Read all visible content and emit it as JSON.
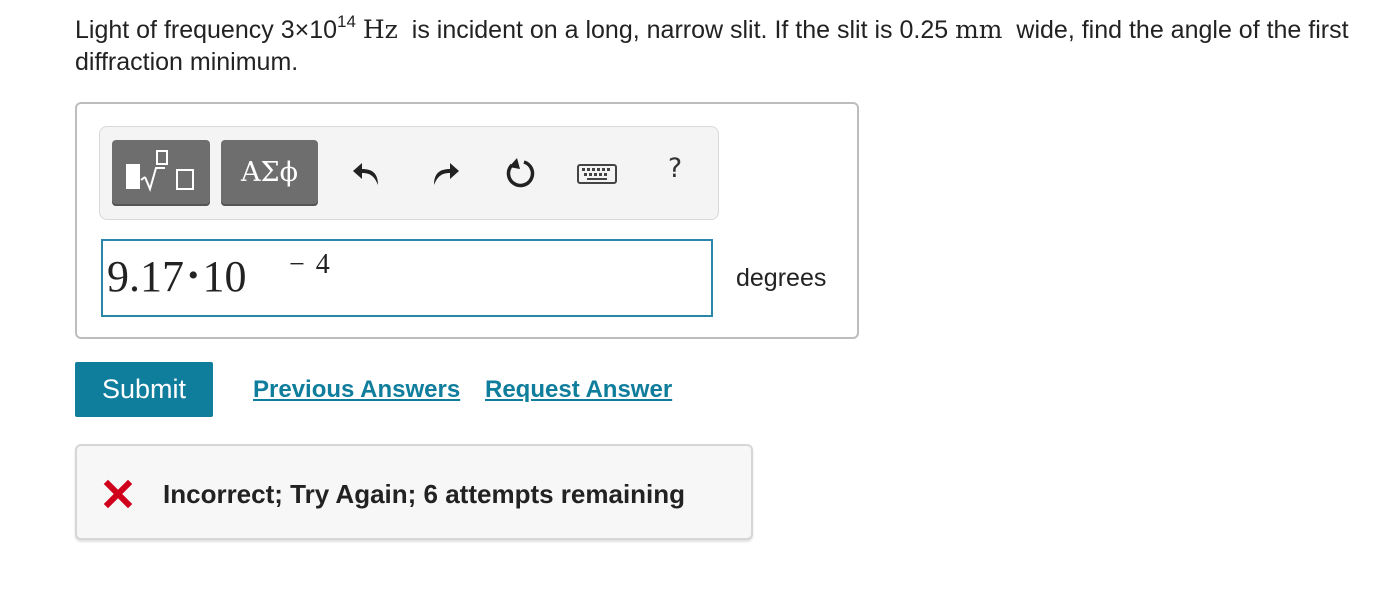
{
  "question": {
    "part1": "Light of frequency 3×10",
    "exponent": "14",
    "unit_hz": "Hz",
    "part2": " is incident on a long, narrow slit.  If the slit is 0.25 ",
    "unit_mm": "mm",
    "part3": " wide, find the angle of the first diffraction minimum."
  },
  "toolbar": {
    "templates_icon": "templates-sqrt-icon",
    "greek_label": "ΑΣϕ",
    "undo_icon": "undo-icon",
    "redo_icon": "redo-icon",
    "reset_icon": "reset-icon",
    "keyboard_icon": "keyboard-icon",
    "help_label": "?"
  },
  "answer": {
    "mantissa": "9.17",
    "times": "•",
    "base": "10",
    "exponent": "− 4",
    "units": "degrees"
  },
  "actions": {
    "submit_label": "Submit",
    "previous_answers_label": "Previous Answers",
    "request_answer_label": "Request Answer"
  },
  "feedback": {
    "icon": "x-mark-icon",
    "message": "Incorrect; Try Again; 6 attempts remaining"
  },
  "colors": {
    "accent": "#0f7d9c",
    "input_border": "#2b87a8",
    "error_red": "#d0021b",
    "toolbar_button": "#6e6e6e"
  }
}
